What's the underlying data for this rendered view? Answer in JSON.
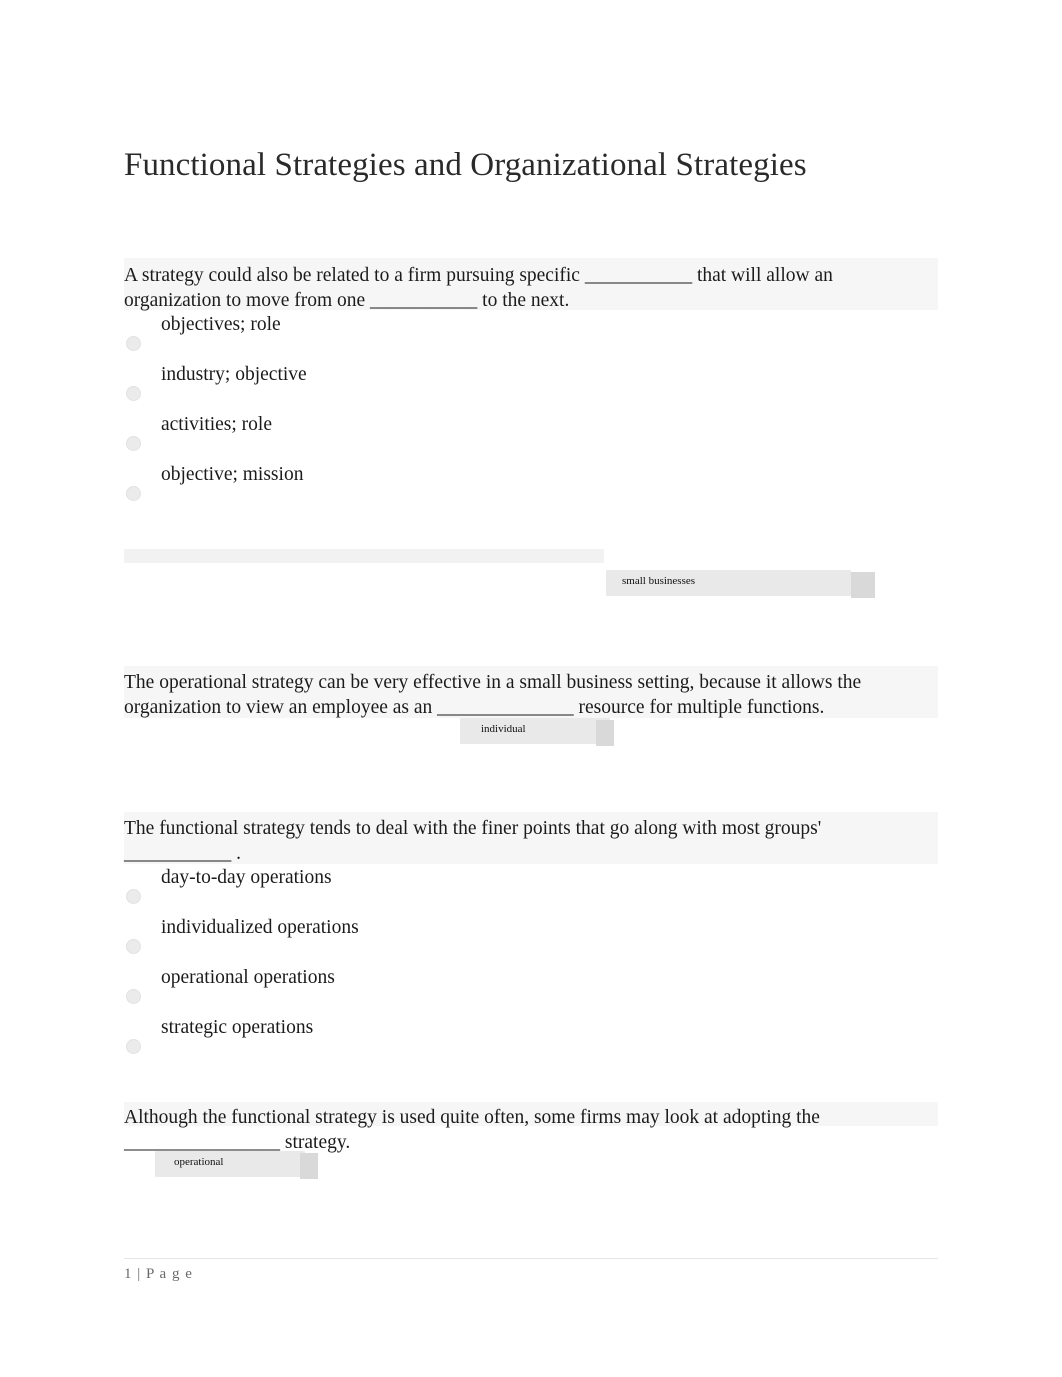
{
  "document": {
    "title": "Functional Strategies and Organizational Strategies",
    "footer": "1 | P a g e"
  },
  "questions": [
    {
      "text": "A strategy could also be related to a firm pursuing specific ___________ that will allow an organization to move from one ___________ to the next.",
      "options": [
        "objectives; role",
        "industry; objective",
        "activities; role",
        "objective; mission"
      ]
    },
    {
      "text": "The operational strategy can be very effective in a small business setting, because it allows the organization to view an employee as an ______________ resource for multiple functions.",
      "options": []
    },
    {
      "text": "The functional strategy tends to deal with the finer points that go along with most groups' ___________ .",
      "options": [
        "day-to-day operations",
        "individualized operations",
        "operational operations",
        "strategic operations"
      ]
    },
    {
      "text": "Although the functional strategy is used quite often, some firms may look at adopting the ________________ strategy.",
      "options": []
    }
  ],
  "answer_chips": [
    {
      "label": "small businesses"
    },
    {
      "label": "individual"
    },
    {
      "label": "operational"
    }
  ]
}
